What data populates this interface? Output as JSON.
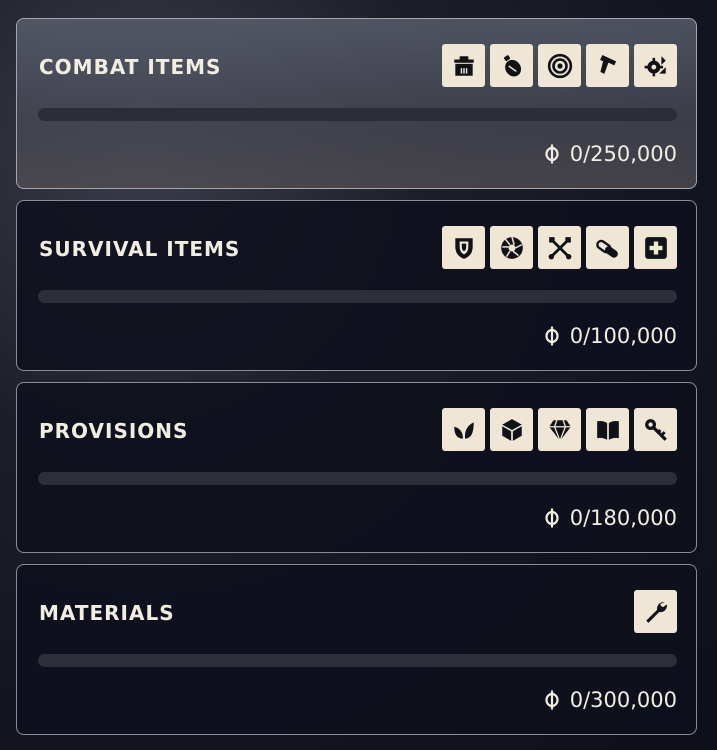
{
  "colors": {
    "icon_background": "#efe6d6",
    "icon_foreground": "#111217",
    "text": "#f2ede2",
    "progress_track": "#2c2f3a",
    "panel_border": "#8a8d96"
  },
  "categories": [
    {
      "title": "COMBAT ITEMS",
      "selected": true,
      "progress_fraction": 0,
      "value_text": "0/250,000",
      "icons": [
        "ammo-crate-icon",
        "grenade-icon",
        "target-icon",
        "pistol-icon",
        "gear-upgrade-icon"
      ]
    },
    {
      "title": "SURVIVAL ITEMS",
      "selected": false,
      "progress_fraction": 0,
      "value_text": "0/100,000",
      "icons": [
        "shield-icon",
        "aperture-icon",
        "crossed-tools-icon",
        "pills-icon",
        "medkit-icon"
      ]
    },
    {
      "title": "PROVISIONS",
      "selected": false,
      "progress_fraction": 0,
      "value_text": "0/180,000",
      "icons": [
        "leaf-icon",
        "box-icon",
        "diamond-icon",
        "book-icon",
        "key-icon"
      ]
    },
    {
      "title": "MATERIALS",
      "selected": false,
      "progress_fraction": 0,
      "value_text": "0/300,000",
      "icons": [
        "wrench-icon"
      ]
    }
  ],
  "currency_icon": "currency-icon"
}
